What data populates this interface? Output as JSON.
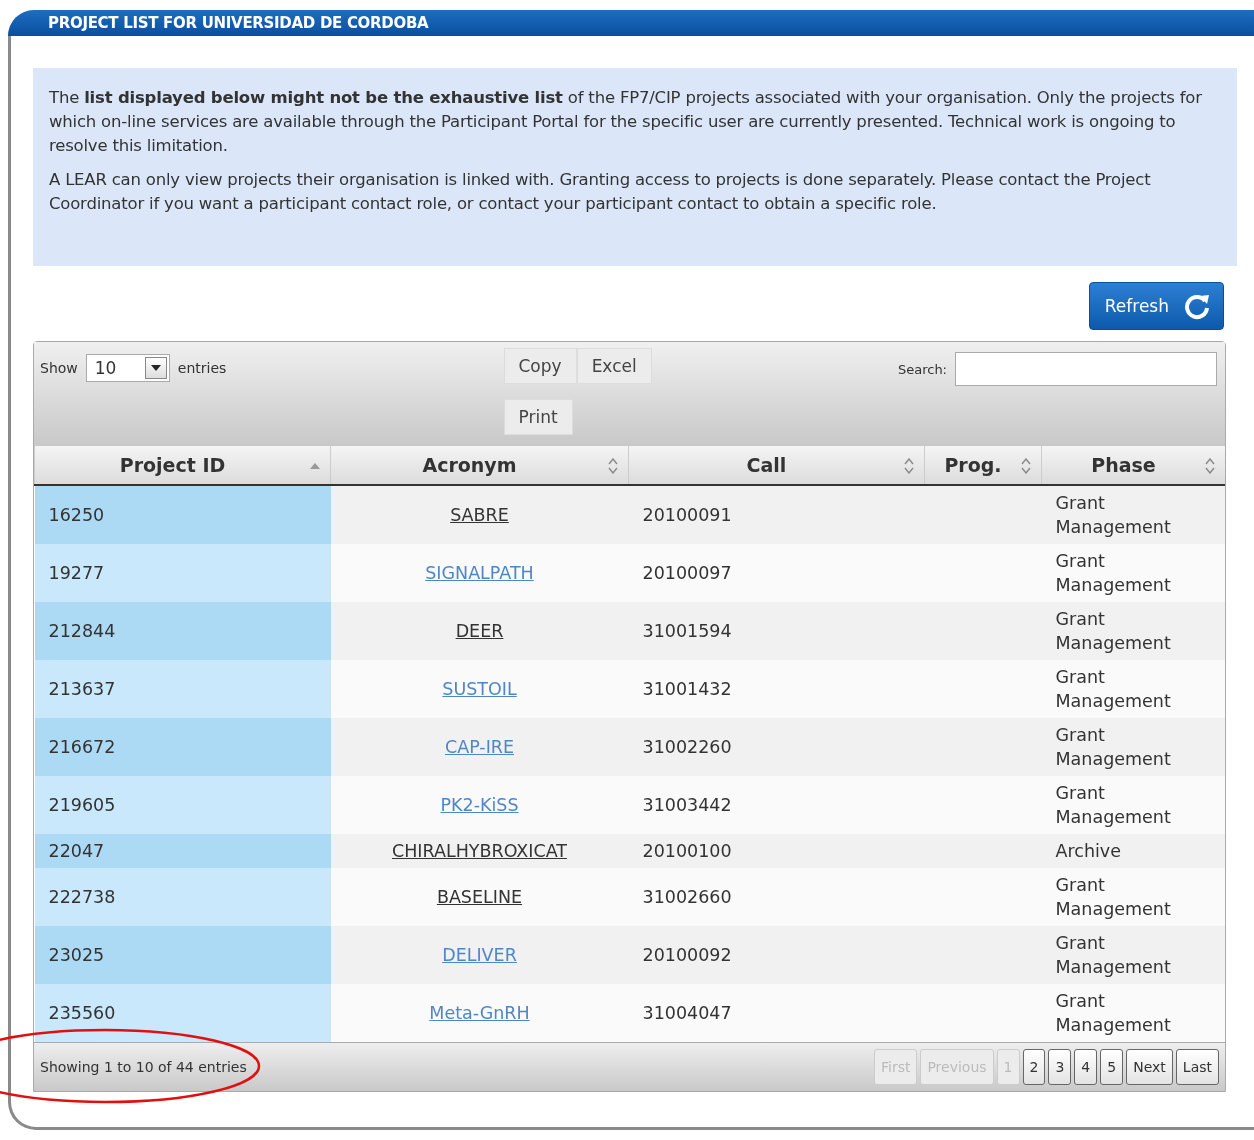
{
  "panel": {
    "title": "PROJECT LIST FOR UNIVERSIDAD DE CORDOBA"
  },
  "notice": {
    "paragraphs": [
      "The **list displayed below might not be the exhaustive list** of the FP7/CIP projects associated with your organisation. Only the projects for which on-line services are available through the Participant Portal for the specific user are currently presented. Technical work is ongoing to resolve this limitation.",
      "A LEAR can only view projects their organisation is linked with. Granting access to projects is done separately. Please contact the Project Coordinator if you want a participant contact role, or contact your participant contact to obtain a specific role."
    ]
  },
  "refresh_button": "Refresh",
  "toolbar": {
    "show_label": "Show",
    "page_size": "10",
    "entries_label": "entries",
    "export_buttons": [
      "Copy",
      "Excel",
      "Print"
    ],
    "search_label": "Search:"
  },
  "table": {
    "columns": [
      {
        "label": "Project ID",
        "sorted": true
      },
      {
        "label": "Acronym",
        "sorted": false
      },
      {
        "label": "Call",
        "sorted": false
      },
      {
        "label": "Prog.",
        "sorted": false
      },
      {
        "label": "Phase",
        "sorted": false
      }
    ],
    "rows": [
      {
        "id": "16250",
        "acronym": "SABRE",
        "visited": true,
        "call": "20100091",
        "phase": "Grant Management"
      },
      {
        "id": "19277",
        "acronym": "SIGNALPATH",
        "visited": false,
        "call": "20100097",
        "phase": "Grant Management"
      },
      {
        "id": "212844",
        "acronym": "DEER",
        "visited": true,
        "call": "31001594",
        "phase": "Grant Management"
      },
      {
        "id": "213637",
        "acronym": "SUSTOIL",
        "visited": false,
        "call": "31001432",
        "phase": "Grant Management"
      },
      {
        "id": "216672",
        "acronym": "CAP-IRE",
        "visited": false,
        "call": "31002260",
        "phase": "Grant Management"
      },
      {
        "id": "219605",
        "acronym": "PK2-KiSS",
        "visited": false,
        "call": "31003442",
        "phase": "Grant Management"
      },
      {
        "id": "22047",
        "acronym": "CHIRALHYBROXICAT",
        "visited": true,
        "call": "20100100",
        "phase": "Archive"
      },
      {
        "id": "222738",
        "acronym": "BASELINE",
        "visited": true,
        "call": "31002660",
        "phase": "Grant Management"
      },
      {
        "id": "23025",
        "acronym": "DELIVER",
        "visited": false,
        "call": "20100092",
        "phase": "Grant Management"
      },
      {
        "id": "235560",
        "acronym": "Meta-GnRH",
        "visited": false,
        "call": "31004047",
        "phase": "Grant Management"
      }
    ]
  },
  "footer": {
    "info": "Showing 1 to 10 of 44 entries",
    "pager": [
      {
        "label": "First",
        "disabled": true
      },
      {
        "label": "Previous",
        "disabled": true
      },
      {
        "label": "1",
        "disabled": true
      },
      {
        "label": "2",
        "disabled": false
      },
      {
        "label": "3",
        "disabled": false
      },
      {
        "label": "4",
        "disabled": false
      },
      {
        "label": "5",
        "disabled": false
      },
      {
        "label": "Next",
        "disabled": false
      },
      {
        "label": "Last",
        "disabled": false
      }
    ]
  },
  "annotation": {
    "kind": "ellipse",
    "color": "#e01010"
  }
}
